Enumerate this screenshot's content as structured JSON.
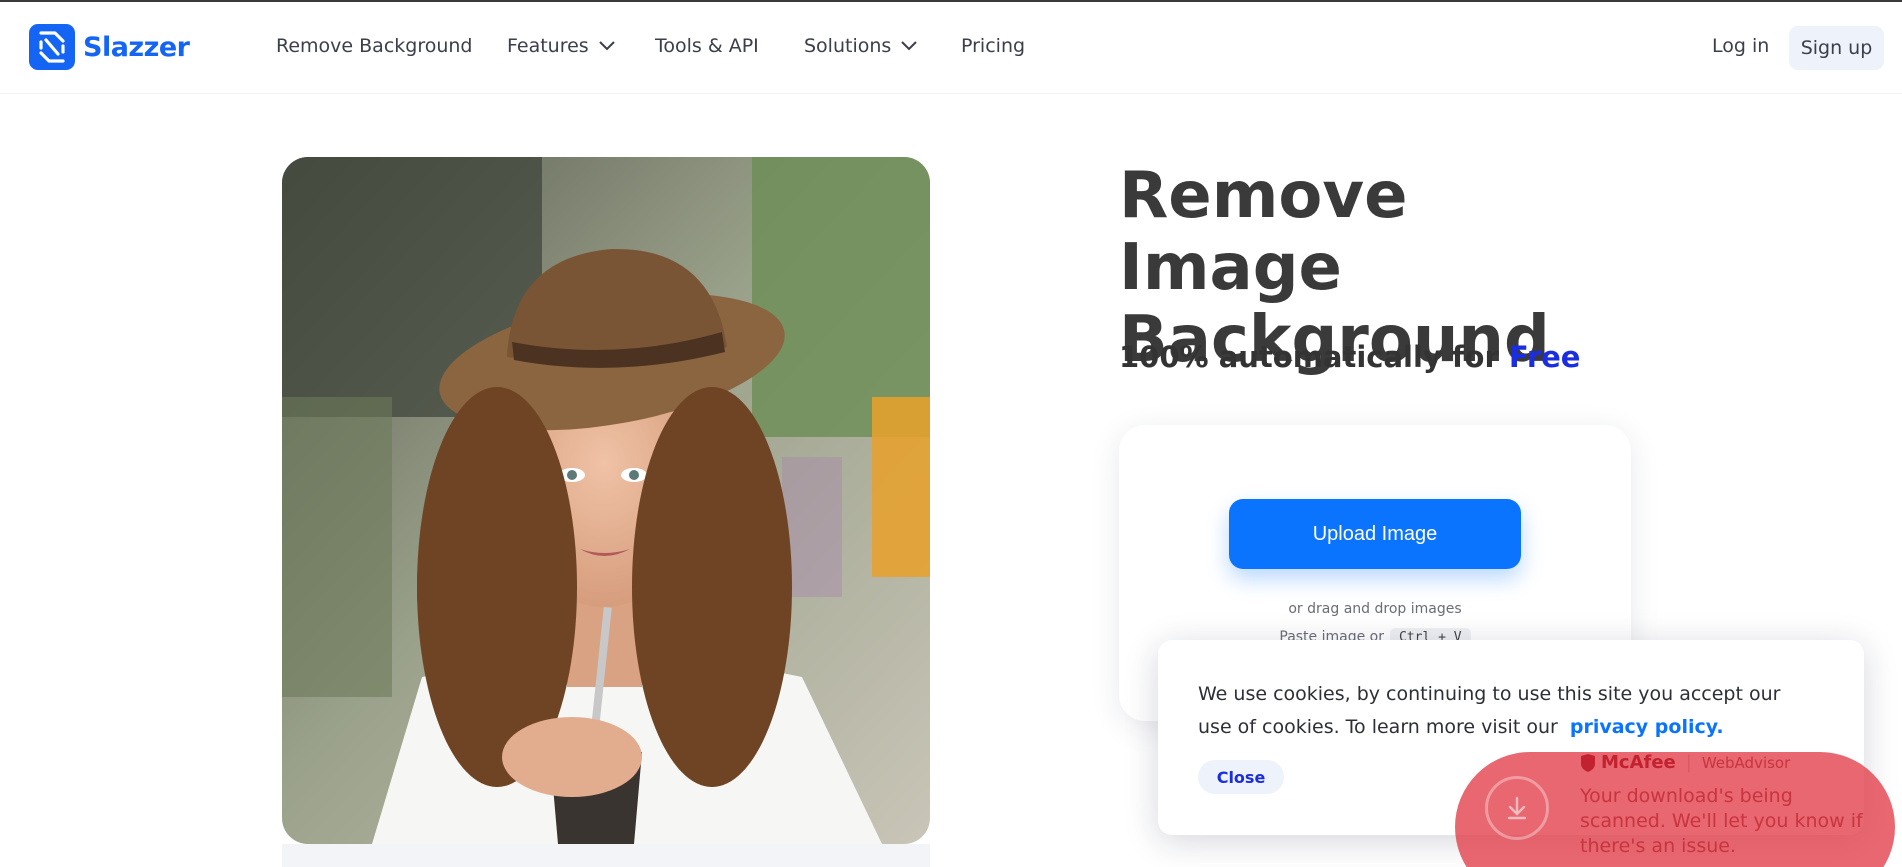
{
  "brand": {
    "name": "Slazzer",
    "color": "#1565f5"
  },
  "nav": {
    "items": [
      {
        "label": "Remove Background",
        "has_dropdown": false
      },
      {
        "label": "Features",
        "has_dropdown": true
      },
      {
        "label": "Tools & API",
        "has_dropdown": false
      },
      {
        "label": "Solutions",
        "has_dropdown": true
      },
      {
        "label": "Pricing",
        "has_dropdown": false
      }
    ],
    "login_label": "Log in",
    "signup_label": "Sign up"
  },
  "hero": {
    "title": "Remove Image Background",
    "subtitle_prefix": "100% automatically for",
    "subtitle_highlight": "Free",
    "highlight_color": "#1a2de0"
  },
  "upload": {
    "button_label": "Upload Image",
    "button_color": "#0a74ff",
    "drag_text": "or drag and drop images",
    "paste_text": "Paste image or",
    "paste_shortcut": "Ctrl + V"
  },
  "cookie_banner": {
    "text": "We use cookies, by continuing to use this site you accept our use of cookies.  To learn more visit our",
    "link_label": "privacy policy.",
    "close_label": "Close"
  },
  "mcafee_toast": {
    "brand": "McAfee",
    "product": "WebAdvisor",
    "message": "Your download's being scanned. We'll let you know if there's an issue."
  }
}
